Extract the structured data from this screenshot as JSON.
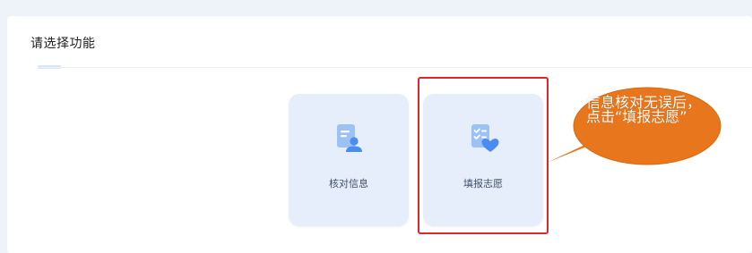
{
  "section": {
    "title": "请选择功能"
  },
  "cards": [
    {
      "label": "核对信息",
      "icon": "document-user-icon"
    },
    {
      "label": "填报志愿",
      "icon": "checklist-heart-icon"
    }
  ],
  "annotation": {
    "text": "信息核对无误后，点击“填报志愿”"
  },
  "colors": {
    "page_background": "#eef3fa",
    "card_background": "#e6eefb",
    "icon_primary": "#4a8df0",
    "icon_secondary": "#9cc2f5",
    "highlight_border": "#e0262a",
    "callout_fill": "#e8761d"
  }
}
